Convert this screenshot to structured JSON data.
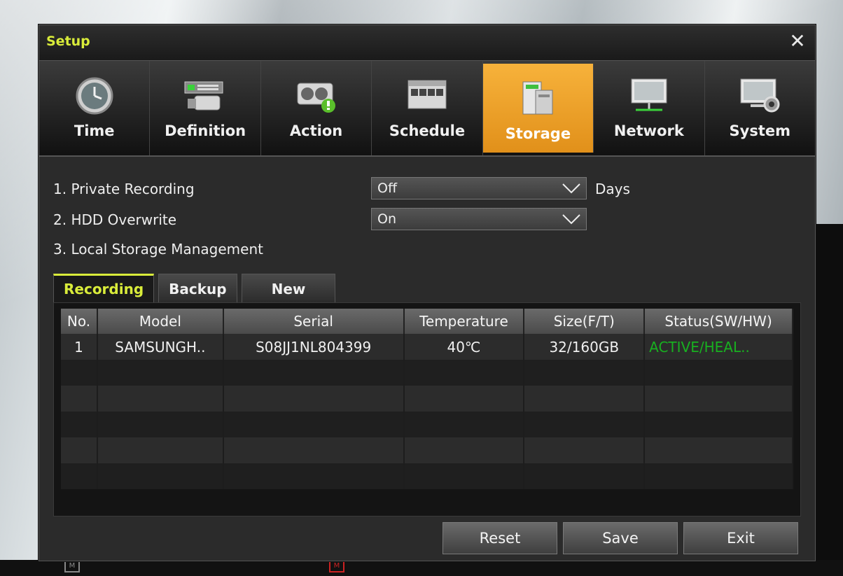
{
  "dialog": {
    "title": "Setup",
    "close_label": "✕"
  },
  "menu": [
    {
      "label": "Time",
      "icon": "clock-icon",
      "active": false
    },
    {
      "label": "Definition",
      "icon": "camera-definition-icon",
      "active": false
    },
    {
      "label": "Action",
      "icon": "action-alert-icon",
      "active": false
    },
    {
      "label": "Schedule",
      "icon": "calendar-icon",
      "active": false
    },
    {
      "label": "Storage",
      "icon": "storage-icon",
      "active": true
    },
    {
      "label": "Network",
      "icon": "monitor-network-icon",
      "active": false
    },
    {
      "label": "System",
      "icon": "system-gear-icon",
      "active": false
    }
  ],
  "settings": {
    "private_recording": {
      "label": "1. Private Recording",
      "value": "Off",
      "unit": "Days"
    },
    "hdd_overwrite": {
      "label": "2. HDD Overwrite",
      "value": "On"
    },
    "local_storage": {
      "label": "3. Local Storage Management"
    }
  },
  "tabs": [
    {
      "label": "Recording",
      "active": true
    },
    {
      "label": "Backup",
      "active": false
    },
    {
      "label": "New",
      "active": false
    }
  ],
  "table": {
    "headers": [
      "No.",
      "Model",
      "Serial",
      "Temperature",
      "Size(F/T)",
      "Status(SW/HW)"
    ],
    "rows": [
      [
        "1",
        "SAMSUNGH..",
        "S08JJ1NL804399",
        "40℃",
        "32/160GB",
        "ACTIVE/HEAL.."
      ],
      [
        "",
        "",
        "",
        "",
        "",
        ""
      ],
      [
        "",
        "",
        "",
        "",
        "",
        ""
      ],
      [
        "",
        "",
        "",
        "",
        "",
        ""
      ],
      [
        "",
        "",
        "",
        "",
        "",
        ""
      ],
      [
        "",
        "",
        "",
        "",
        "",
        ""
      ]
    ]
  },
  "buttons": {
    "reset": "Reset",
    "save": "Save",
    "exit": "Exit"
  },
  "colors": {
    "accent_title": "#d9ec3a",
    "active_menu": "#f0a02a",
    "status_ok": "#18b020"
  }
}
